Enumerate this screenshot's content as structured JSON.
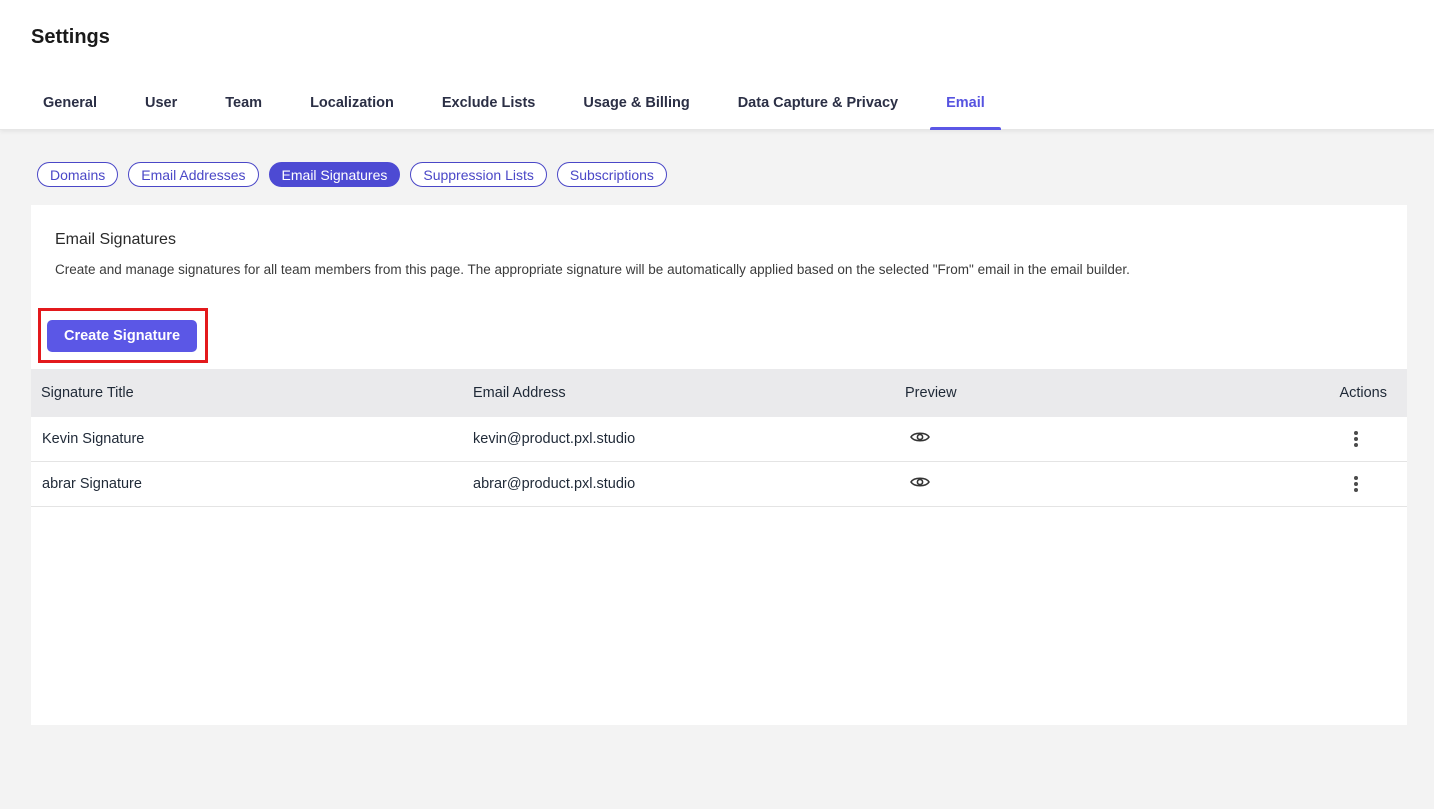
{
  "page": {
    "title": "Settings"
  },
  "tabs": [
    {
      "label": "General",
      "active": false
    },
    {
      "label": "User",
      "active": false
    },
    {
      "label": "Team",
      "active": false
    },
    {
      "label": "Localization",
      "active": false
    },
    {
      "label": "Exclude Lists",
      "active": false
    },
    {
      "label": "Usage & Billing",
      "active": false
    },
    {
      "label": "Data Capture & Privacy",
      "active": false
    },
    {
      "label": "Email",
      "active": true
    }
  ],
  "subtabs": [
    {
      "label": "Domains",
      "active": false
    },
    {
      "label": "Email Addresses",
      "active": false
    },
    {
      "label": "Email Signatures",
      "active": true
    },
    {
      "label": "Suppression Lists",
      "active": false
    },
    {
      "label": "Subscriptions",
      "active": false
    }
  ],
  "section": {
    "title": "Email Signatures",
    "description": "Create and manage signatures for all team members from this page. The appropriate signature will be automatically applied based on the selected \"From\" email in the email builder.",
    "create_button": "Create Signature"
  },
  "table": {
    "columns": [
      "Signature Title",
      "Email Address",
      "Preview",
      "Actions"
    ],
    "rows": [
      {
        "title": "Kevin Signature",
        "email": "kevin@product.pxl.studio",
        "preview_icon": "eye-icon",
        "actions_icon": "kebab-icon"
      },
      {
        "title": "abrar Signature",
        "email": "abrar@product.pxl.studio",
        "preview_icon": "eye-icon",
        "actions_icon": "kebab-icon"
      }
    ]
  },
  "colors": {
    "accent": "#5b57e6",
    "highlight": "#e3191c",
    "background": "#f3f3f3"
  }
}
